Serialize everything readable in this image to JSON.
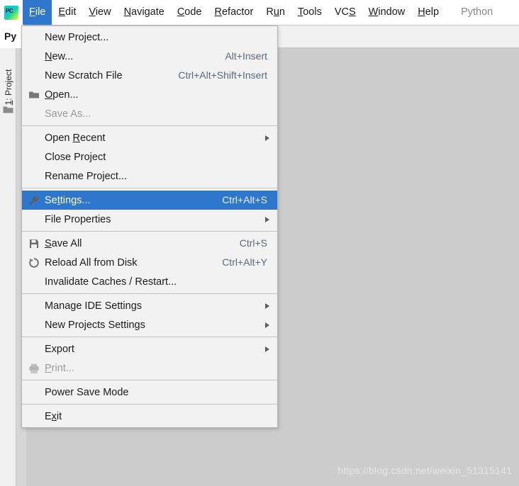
{
  "app": {
    "logo_icon": "pycharm-logo-icon",
    "product_label": "Python"
  },
  "menubar": {
    "items": [
      {
        "label": "File",
        "mnemonic": "F",
        "active": true
      },
      {
        "label": "Edit",
        "mnemonic": "E",
        "active": false
      },
      {
        "label": "View",
        "mnemonic": "V",
        "active": false
      },
      {
        "label": "Navigate",
        "mnemonic": "N",
        "active": false
      },
      {
        "label": "Code",
        "mnemonic": "C",
        "active": false
      },
      {
        "label": "Refactor",
        "mnemonic": "R",
        "active": false
      },
      {
        "label": "Run",
        "mnemonic": "u",
        "active": false
      },
      {
        "label": "Tools",
        "mnemonic": "T",
        "active": false
      },
      {
        "label": "VCS",
        "mnemonic": "S",
        "active": false
      },
      {
        "label": "Window",
        "mnemonic": "W",
        "active": false
      },
      {
        "label": "Help",
        "mnemonic": "H",
        "active": false
      }
    ]
  },
  "editor": {
    "tab_label": "Py"
  },
  "sidebar": {
    "tool_window_label": "1: Project",
    "tool_window_mnemonic": "1",
    "folder_icon": "folder-icon"
  },
  "file_menu": {
    "items": [
      {
        "type": "item",
        "label": "New Project...",
        "accel": "",
        "icon": "",
        "arrow": false,
        "disabled": false,
        "selected": false,
        "mnemonic": ""
      },
      {
        "type": "item",
        "label": "New...",
        "accel": "Alt+Insert",
        "icon": "",
        "arrow": false,
        "disabled": false,
        "selected": false,
        "mnemonic": "N"
      },
      {
        "type": "item",
        "label": "New Scratch File",
        "accel": "Ctrl+Alt+Shift+Insert",
        "icon": "",
        "arrow": false,
        "disabled": false,
        "selected": false,
        "mnemonic": ""
      },
      {
        "type": "item",
        "label": "Open...",
        "accel": "",
        "icon": "folder-icon",
        "arrow": false,
        "disabled": false,
        "selected": false,
        "mnemonic": "O"
      },
      {
        "type": "item",
        "label": "Save As...",
        "accel": "",
        "icon": "",
        "arrow": false,
        "disabled": true,
        "selected": false,
        "mnemonic": ""
      },
      {
        "type": "separator"
      },
      {
        "type": "item",
        "label": "Open Recent",
        "accel": "",
        "icon": "",
        "arrow": true,
        "disabled": false,
        "selected": false,
        "mnemonic": "R"
      },
      {
        "type": "item",
        "label": "Close Project",
        "accel": "",
        "icon": "",
        "arrow": false,
        "disabled": false,
        "selected": false,
        "mnemonic": ""
      },
      {
        "type": "item",
        "label": "Rename Project...",
        "accel": "",
        "icon": "",
        "arrow": false,
        "disabled": false,
        "selected": false,
        "mnemonic": ""
      },
      {
        "type": "separator"
      },
      {
        "type": "item",
        "label": "Settings...",
        "accel": "Ctrl+Alt+S",
        "icon": "wrench-icon",
        "arrow": false,
        "disabled": false,
        "selected": true,
        "mnemonic": "t"
      },
      {
        "type": "item",
        "label": "File Properties",
        "accel": "",
        "icon": "",
        "arrow": true,
        "disabled": false,
        "selected": false,
        "mnemonic": ""
      },
      {
        "type": "separator"
      },
      {
        "type": "item",
        "label": "Save All",
        "accel": "Ctrl+S",
        "icon": "save-icon",
        "arrow": false,
        "disabled": false,
        "selected": false,
        "mnemonic": "S"
      },
      {
        "type": "item",
        "label": "Reload All from Disk",
        "accel": "Ctrl+Alt+Y",
        "icon": "reload-icon",
        "arrow": false,
        "disabled": false,
        "selected": false,
        "mnemonic": ""
      },
      {
        "type": "item",
        "label": "Invalidate Caches / Restart...",
        "accel": "",
        "icon": "",
        "arrow": false,
        "disabled": false,
        "selected": false,
        "mnemonic": ""
      },
      {
        "type": "separator"
      },
      {
        "type": "item",
        "label": "Manage IDE Settings",
        "accel": "",
        "icon": "",
        "arrow": true,
        "disabled": false,
        "selected": false,
        "mnemonic": ""
      },
      {
        "type": "item",
        "label": "New Projects Settings",
        "accel": "",
        "icon": "",
        "arrow": true,
        "disabled": false,
        "selected": false,
        "mnemonic": ""
      },
      {
        "type": "separator"
      },
      {
        "type": "item",
        "label": "Export",
        "accel": "",
        "icon": "",
        "arrow": true,
        "disabled": false,
        "selected": false,
        "mnemonic": ""
      },
      {
        "type": "item",
        "label": "Print...",
        "accel": "",
        "icon": "printer-icon",
        "arrow": false,
        "disabled": true,
        "selected": false,
        "mnemonic": "P"
      },
      {
        "type": "separator"
      },
      {
        "type": "item",
        "label": "Power Save Mode",
        "accel": "",
        "icon": "",
        "arrow": false,
        "disabled": false,
        "selected": false,
        "mnemonic": ""
      },
      {
        "type": "separator"
      },
      {
        "type": "item",
        "label": "Exit",
        "accel": "",
        "icon": "",
        "arrow": false,
        "disabled": false,
        "selected": false,
        "mnemonic": "x"
      }
    ]
  },
  "watermark": {
    "text": "https://blog.csdn.net/weixin_51315141"
  },
  "colors": {
    "selection": "#2f77cd",
    "menu_bg": "#f2f2f2",
    "window_bg": "#cccccc",
    "accel_text": "#5d6a7a",
    "disabled_text": "#9b9b9b"
  }
}
